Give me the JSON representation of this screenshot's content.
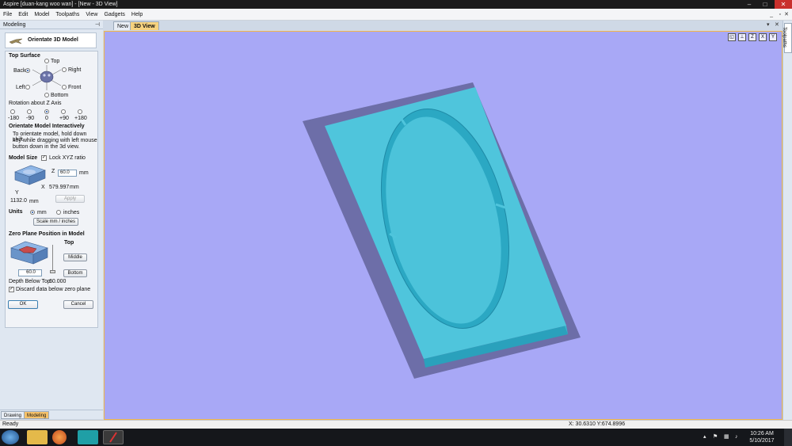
{
  "window": {
    "title": "Aspire [duan-kang woo wan] - [New - 3D View]"
  },
  "menu": {
    "items": [
      "File",
      "Edit",
      "Model",
      "Toolpaths",
      "View",
      "Gadgets",
      "Help"
    ]
  },
  "left_panel": {
    "header": "Modeling",
    "form_title": "Orientate 3D Model",
    "top_surface": {
      "label": "Top Surface",
      "options": {
        "top": "Top",
        "back": "Back",
        "right": "Right",
        "left": "Left",
        "front": "Front",
        "bottom": "Bottom"
      },
      "selected": "Back"
    },
    "rotation": {
      "label": "Rotation about Z Axis",
      "options": [
        "-180",
        "-90",
        "0",
        "+90",
        "+180"
      ],
      "selected": "0"
    },
    "interactive": {
      "label": "Orientate Model Interactively",
      "text1": "To orientate model, hold down shift",
      "text2": "key while dragging with left mouse",
      "text3": "button down in the  3d view."
    },
    "model_size": {
      "label": "Model Size",
      "lock_label": "Lock XYZ ratio",
      "lock_checked": true,
      "z_value": "60.0",
      "z_unit": "mm",
      "x_value": "579.997",
      "x_unit": "mm",
      "y_value": "1132.0",
      "y_unit": "mm",
      "axis_z": "Z",
      "axis_x": "X",
      "axis_y": "Y",
      "apply_label": "Apply"
    },
    "units": {
      "label": "Units",
      "mm": "mm",
      "inches": "inches",
      "selected": "mm",
      "scale_label": "Scale mm / inches"
    },
    "zero_plane": {
      "label": "Zero Plane Position in Model",
      "top": "Top",
      "middle": "Middle",
      "bottom": "Bottom",
      "value": "60.0",
      "depth_label": "Depth Below Top:",
      "depth_value": "60.000",
      "discard_label": "Discard data below zero plane",
      "discard_checked": true
    },
    "ok_label": "OK",
    "cancel_label": "Cancel",
    "bottom_tabs": [
      "Drawing",
      "Modeling"
    ]
  },
  "view_tabs": [
    "New",
    "3D View"
  ],
  "side_tab": "Toolpaths",
  "status": {
    "left": "Ready",
    "coords": "X: 30.6310 Y:674.8996"
  },
  "taskbar": {
    "time": "10:26 AM",
    "date": "5/10/2017"
  },
  "colors": {
    "viewport": "#a8a8f6",
    "model": "#4fc5dc",
    "base": "#6d6ea8",
    "accent": "#f6c26a"
  }
}
